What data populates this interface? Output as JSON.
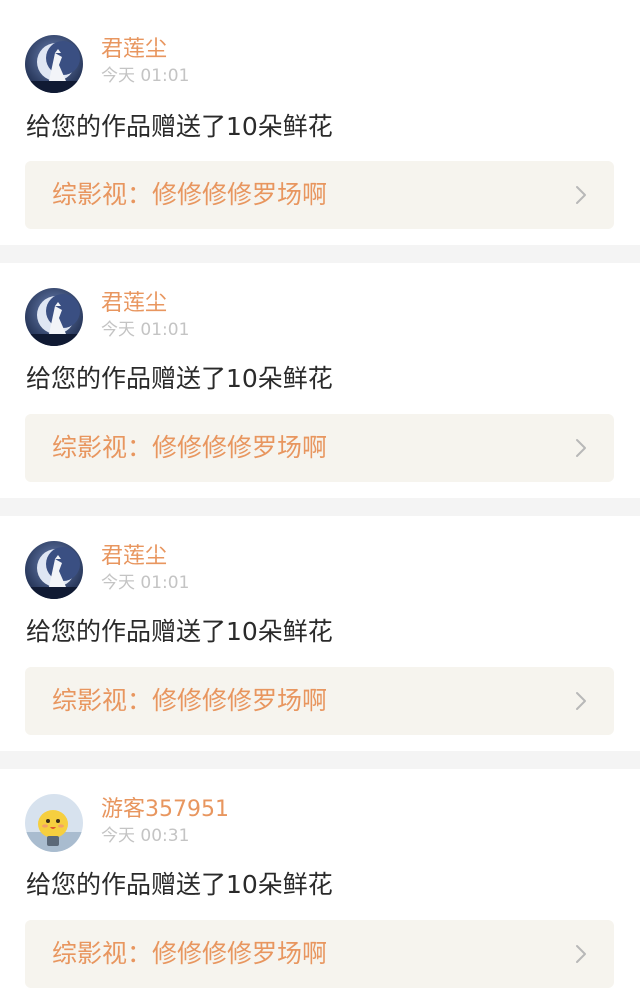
{
  "accent_color": "#e8965f",
  "indicator_color": "#f05a86",
  "notifications": [
    {
      "avatar_icon": "moon-figure-avatar",
      "username": "君莲尘",
      "timestamp": "今天 01:01",
      "message": "给您的作品赠送了10朵鲜花",
      "work_title": "综影视：修修修修罗场啊",
      "chevron_icon": "chevron-right-icon"
    },
    {
      "avatar_icon": "moon-figure-avatar",
      "username": "君莲尘",
      "timestamp": "今天 01:01",
      "message": "给您的作品赠送了10朵鲜花",
      "work_title": "综影视：修修修修罗场啊",
      "chevron_icon": "chevron-right-icon"
    },
    {
      "avatar_icon": "moon-figure-avatar",
      "username": "君莲尘",
      "timestamp": "今天 01:01",
      "message": "给您的作品赠送了10朵鲜花",
      "work_title": "综影视：修修修修罗场啊",
      "chevron_icon": "chevron-right-icon"
    },
    {
      "avatar_icon": "cartoon-chick-avatar",
      "username": "游客357951",
      "timestamp": "今天 00:31",
      "message": "给您的作品赠送了10朵鲜花",
      "work_title": "综影视：修修修修罗场啊",
      "chevron_icon": "chevron-right-icon"
    }
  ]
}
